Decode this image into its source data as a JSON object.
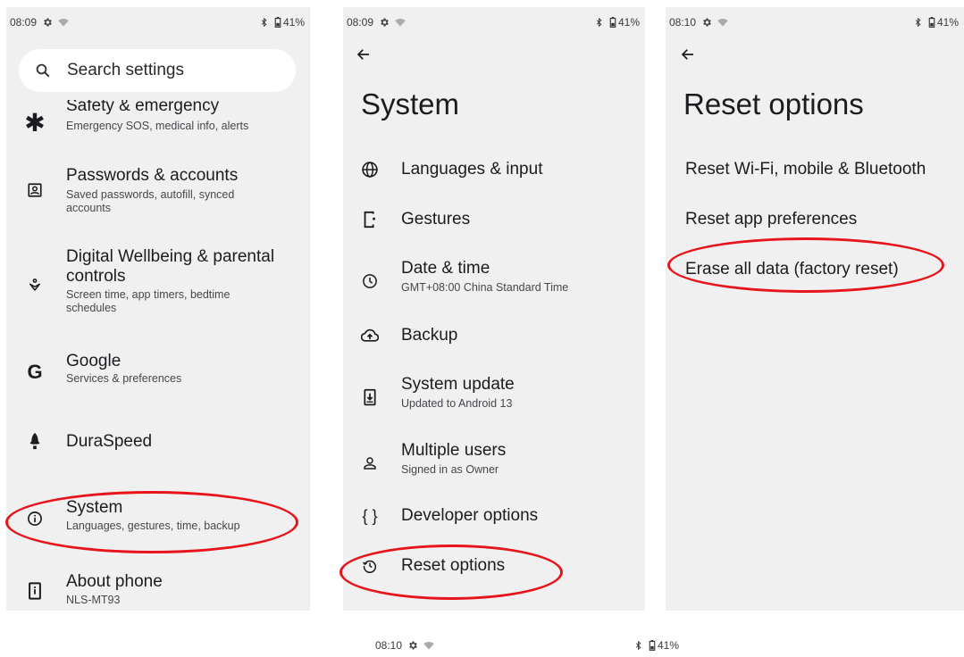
{
  "panel1": {
    "status": {
      "time": "08:09",
      "battery": "41%"
    },
    "search_placeholder": "Search settings",
    "items": [
      {
        "title": "Safety & emergency",
        "subtitle": "Emergency SOS, medical info, alerts"
      },
      {
        "title": "Passwords & accounts",
        "subtitle_l1": "Saved passwords, autofill, synced",
        "subtitle_l2": "accounts"
      },
      {
        "title_l1": "Digital Wellbeing & parental",
        "title_l2": "controls",
        "subtitle_l1": "Screen time, app timers, bedtime",
        "subtitle_l2": "schedules"
      },
      {
        "title": "Google",
        "subtitle": "Services & preferences"
      },
      {
        "title": "DuraSpeed"
      },
      {
        "title": "System",
        "subtitle": "Languages, gestures, time, backup"
      },
      {
        "title": "About phone",
        "subtitle": "NLS-MT93"
      }
    ]
  },
  "panel2": {
    "status": {
      "time": "08:09",
      "battery": "41%"
    },
    "title": "System",
    "items": [
      {
        "title": "Languages & input"
      },
      {
        "title": "Gestures"
      },
      {
        "title": "Date & time",
        "subtitle": "GMT+08:00 China Standard Time"
      },
      {
        "title": "Backup"
      },
      {
        "title": "System update",
        "subtitle": "Updated to Android 13"
      },
      {
        "title": "Multiple users",
        "subtitle": "Signed in as Owner"
      },
      {
        "title": "Developer options",
        "icon_text": "{ }"
      },
      {
        "title": "Reset options"
      }
    ]
  },
  "panel3": {
    "status": {
      "time": "08:10",
      "battery": "41%"
    },
    "title": "Reset options",
    "items": [
      {
        "title": "Reset Wi-Fi, mobile & Bluetooth"
      },
      {
        "title": "Reset app preferences"
      },
      {
        "title": "Erase all data (factory reset)"
      }
    ]
  },
  "bottom_status": {
    "time": "08:10",
    "battery": "41%"
  },
  "colors": {
    "panel_bg": "#f0f0f0",
    "highlight": "#e8141c"
  }
}
